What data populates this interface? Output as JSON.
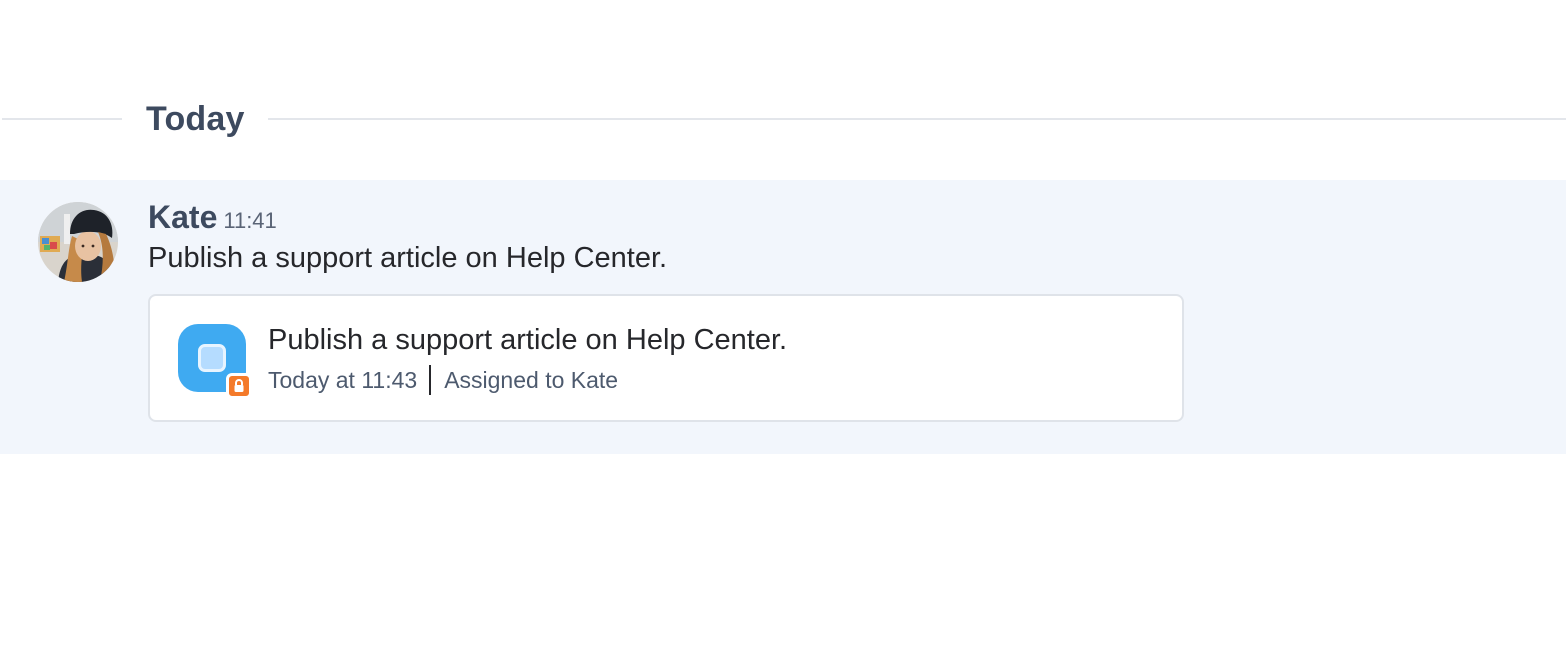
{
  "divider": {
    "label": "Today"
  },
  "message": {
    "author": "Kate",
    "time": "11:41",
    "text": "Publish a support article on Help Center.",
    "task": {
      "title": "Publish a support article on Help Center.",
      "date": "Today at 11:43",
      "assignee": "Assigned to Kate",
      "icon": "task-checkbox-icon",
      "badge_icon": "lock-icon"
    }
  },
  "colors": {
    "message_bg": "#f2f6fc",
    "task_tile": "#3faaf1",
    "lock_badge": "#f47a2a",
    "divider_line": "#e3e6eb",
    "heading": "#3d4a5f"
  }
}
